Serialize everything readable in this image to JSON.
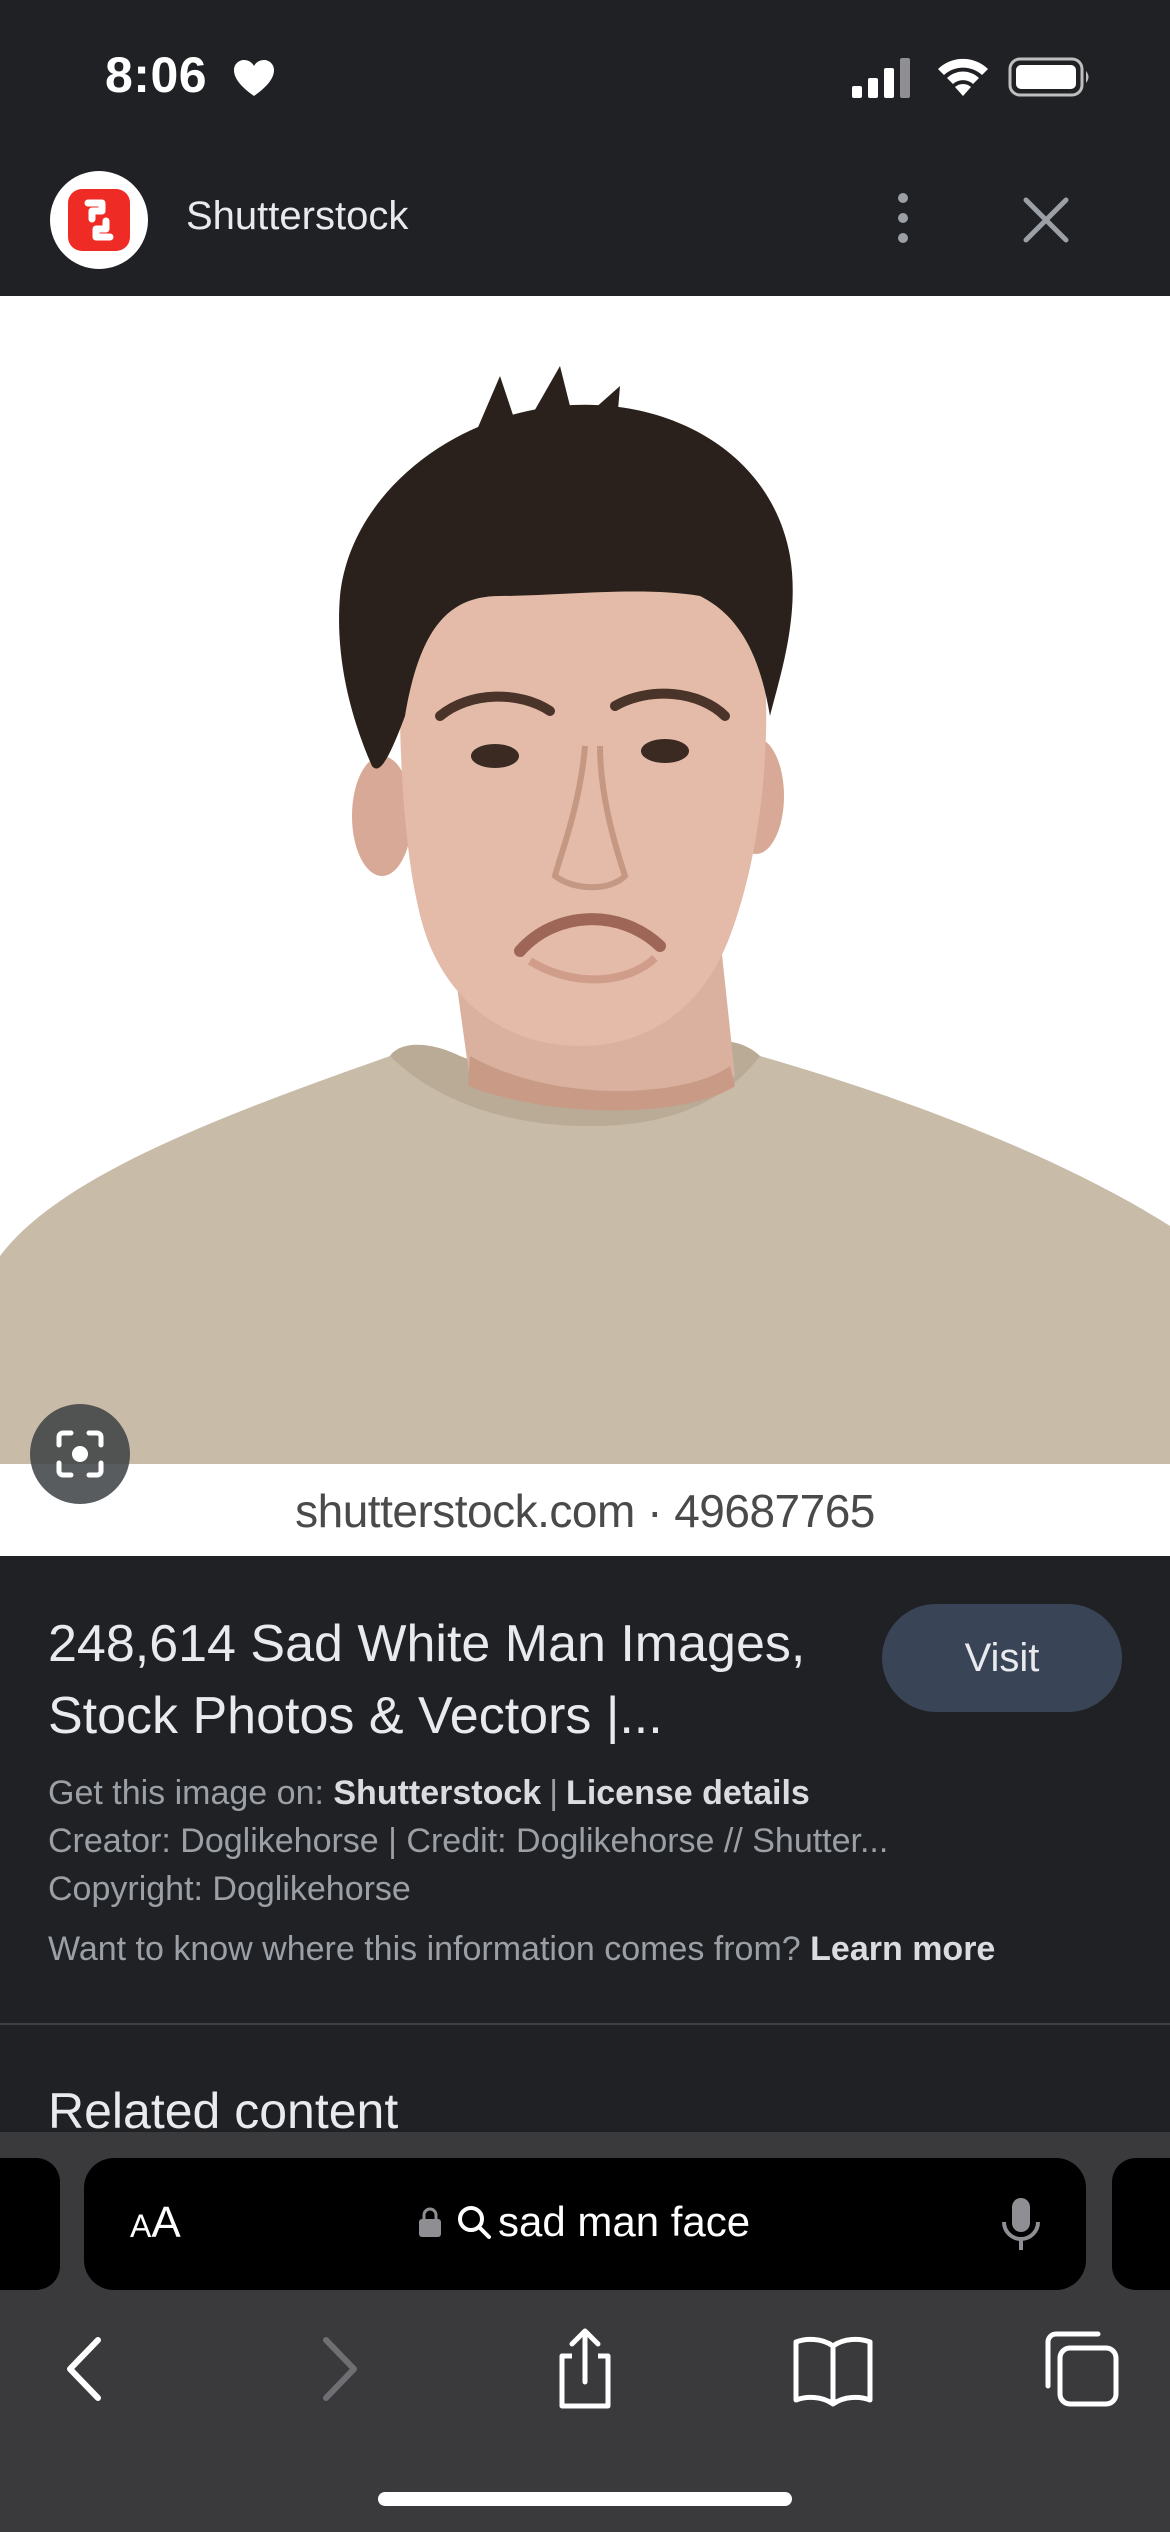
{
  "status_bar": {
    "time": "8:06"
  },
  "sheet": {
    "site_name": "Shutterstock"
  },
  "image": {
    "watermark": "shutterstock.com · 49687765"
  },
  "result": {
    "title": "248,614 Sad White Man Images, Stock Photos & Vectors |...",
    "visit_label": "Visit",
    "get_image_prefix": "Get this image on:",
    "get_image_site": "Shutterstock",
    "license_label": "License details",
    "creator_line": "Creator: Doglikehorse | Credit: Doglikehorse // Shutter...",
    "copyright_line": "Copyright: Doglikehorse",
    "info_question": "Want to know where this information comes from?",
    "learn_more": "Learn more"
  },
  "related": {
    "heading": "Related content"
  },
  "browser": {
    "aa_small": "A",
    "aa_large": "A",
    "address": "sad man face"
  },
  "colors": {
    "background": "#202124",
    "visit_button": "#394457",
    "logo_red": "#ee2b24",
    "browser_chrome": "#3a3a3c"
  },
  "icons": {
    "status": [
      "heart-icon",
      "signal-icon",
      "wifi-icon",
      "battery-icon"
    ],
    "header": [
      "shutterstock-logo-icon",
      "more-vert-icon",
      "close-icon"
    ],
    "image": [
      "lens-icon"
    ],
    "toolbar": [
      "back-icon",
      "forward-icon",
      "share-icon",
      "bookmarks-icon",
      "tabs-icon",
      "lock-icon",
      "search-icon",
      "microphone-icon"
    ]
  }
}
